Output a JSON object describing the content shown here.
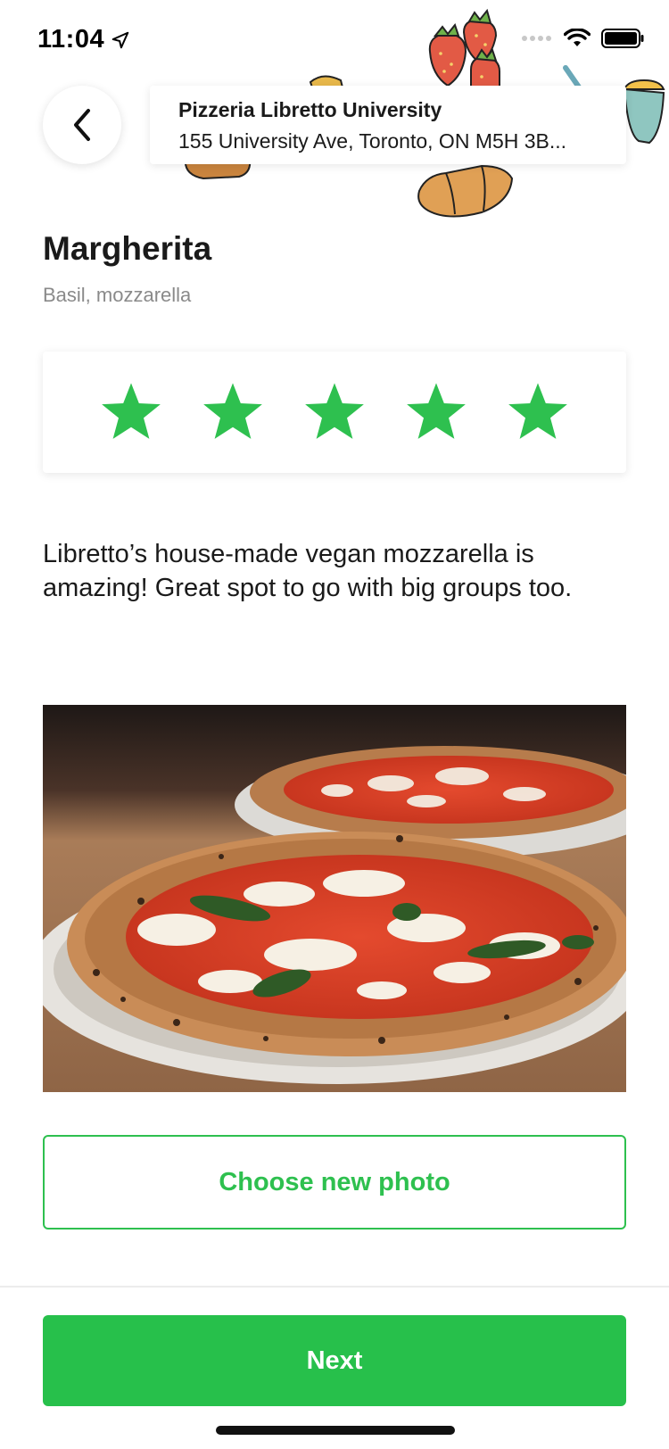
{
  "status_bar": {
    "time": "11:04"
  },
  "place": {
    "name": "Pizzeria Libretto University",
    "address": "155 University Ave, Toronto, ON M5H 3B..."
  },
  "dish": {
    "title": "Margherita",
    "subtitle": "Basil, mozzarella"
  },
  "rating": {
    "value": 5,
    "max": 5,
    "star_color": "#2ec04f"
  },
  "review": {
    "text": "Libretto’s house-made vegan mozzarella is amazing! Great spot to go with big groups too."
  },
  "photo": {
    "subject": "margherita-pizza-photo"
  },
  "buttons": {
    "choose_photo_label": "Choose new photo",
    "next_label": "Next"
  },
  "colors": {
    "accent": "#27c04b",
    "text": "#1a1a1a",
    "muted": "#8a8a8a"
  }
}
